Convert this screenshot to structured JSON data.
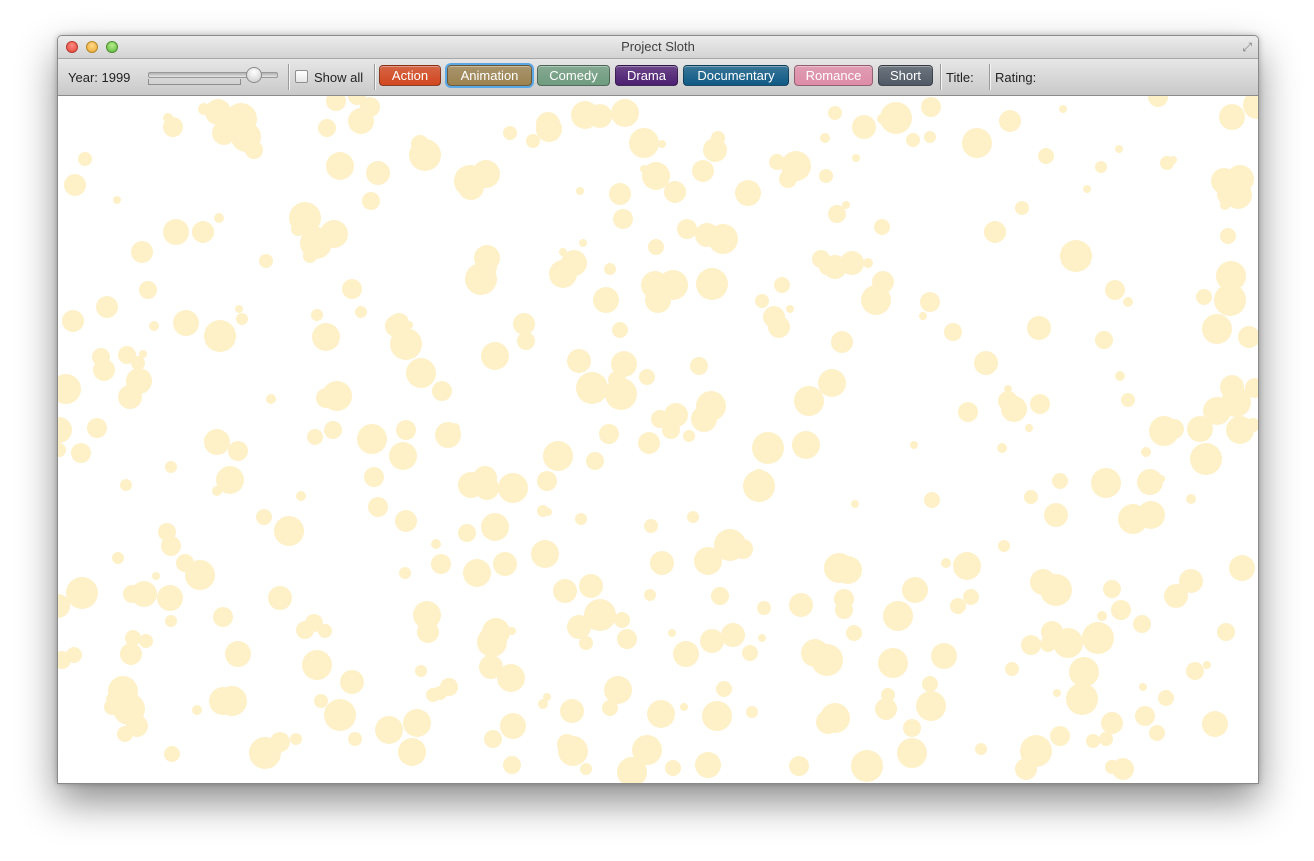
{
  "window": {
    "title": "Project Sloth"
  },
  "toolbar": {
    "year_label": "Year: 1999",
    "year": 1999,
    "show_all_label": "Show all",
    "show_all_checked": false,
    "title_label": "Title:",
    "rating_label": "Rating:"
  },
  "genres": [
    {
      "label": "Action",
      "color": "#d2471f",
      "selected": false
    },
    {
      "label": "Animation",
      "color": "#9b8250",
      "selected": true
    },
    {
      "label": "Comedy",
      "color": "#6f9c7f",
      "selected": false
    },
    {
      "label": "Drama",
      "color": "#4d1f72",
      "selected": false
    },
    {
      "label": "Documentary",
      "color": "#0f5b86",
      "selected": false
    },
    {
      "label": "Romance",
      "color": "#de8ca8",
      "selected": false
    },
    {
      "label": "Short",
      "color": "#505a66",
      "selected": false
    }
  ],
  "colors": {
    "bubble": "#fef0c7"
  }
}
